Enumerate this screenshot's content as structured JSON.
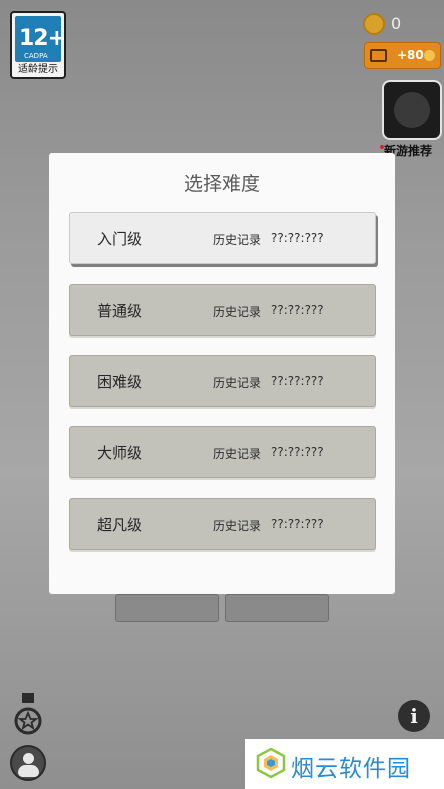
{
  "age_badge": {
    "rating": "12+",
    "org": "CADPA",
    "label": "适龄提示"
  },
  "coins": {
    "count": "0",
    "icon": "coin-icon"
  },
  "reward": {
    "amount": "+80",
    "icon": "video-icon"
  },
  "new_game": {
    "label": "新游推荐"
  },
  "modal": {
    "title": "选择难度",
    "levels": [
      {
        "name": "入门级",
        "history_label": "历史记录",
        "history_value": "??:??:???",
        "selected": true
      },
      {
        "name": "普通级",
        "history_label": "历史记录",
        "history_value": "??:??:???",
        "selected": false
      },
      {
        "name": "困难级",
        "history_label": "历史记录",
        "history_value": "??:??:???",
        "selected": false
      },
      {
        "name": "大师级",
        "history_label": "历史记录",
        "history_value": "??:??:???",
        "selected": false
      },
      {
        "name": "超凡级",
        "history_label": "历史记录",
        "history_value": "??:??:???",
        "selected": false
      }
    ]
  },
  "watermark": {
    "text": "烟云软件园"
  },
  "colors": {
    "selected_level_bg": "#ededed",
    "level_bg": "#c2c2ba",
    "reward_orange": "#e08a1f",
    "badge_blue": "#1f7fb6",
    "watermark_blue": "#2a8ad8"
  }
}
